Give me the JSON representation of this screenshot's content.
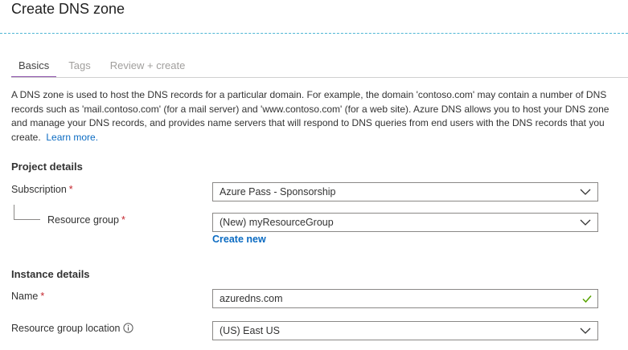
{
  "page": {
    "title": "Create DNS zone"
  },
  "tabs": [
    {
      "label": "Basics"
    },
    {
      "label": "Tags"
    },
    {
      "label": "Review + create"
    }
  ],
  "description": {
    "text": "A DNS zone is used to host the DNS records for a particular domain. For example, the domain 'contoso.com' may contain a number of DNS records such as 'mail.contoso.com' (for a mail server) and 'www.contoso.com' (for a web site). Azure DNS allows you to host your DNS zone and manage your DNS records, and provides name servers that will respond to DNS queries from end users with the DNS records that you create.",
    "learn_more": "Learn more."
  },
  "project_details": {
    "heading": "Project details",
    "subscription": {
      "label": "Subscription",
      "required": "*",
      "value": "Azure Pass - Sponsorship"
    },
    "resource_group": {
      "label": "Resource group",
      "required": "*",
      "value": "(New) myResourceGroup",
      "create_new": "Create new"
    }
  },
  "instance_details": {
    "heading": "Instance details",
    "name": {
      "label": "Name",
      "required": "*",
      "value": "azuredns.com"
    },
    "location": {
      "label": "Resource group location",
      "value": "(US) East US"
    }
  },
  "colors": {
    "accent": "#8a4fa9",
    "link": "#0b6bc2",
    "required": "#c4262e",
    "valid": "#57a300",
    "dashed": "#4fb6d4"
  }
}
